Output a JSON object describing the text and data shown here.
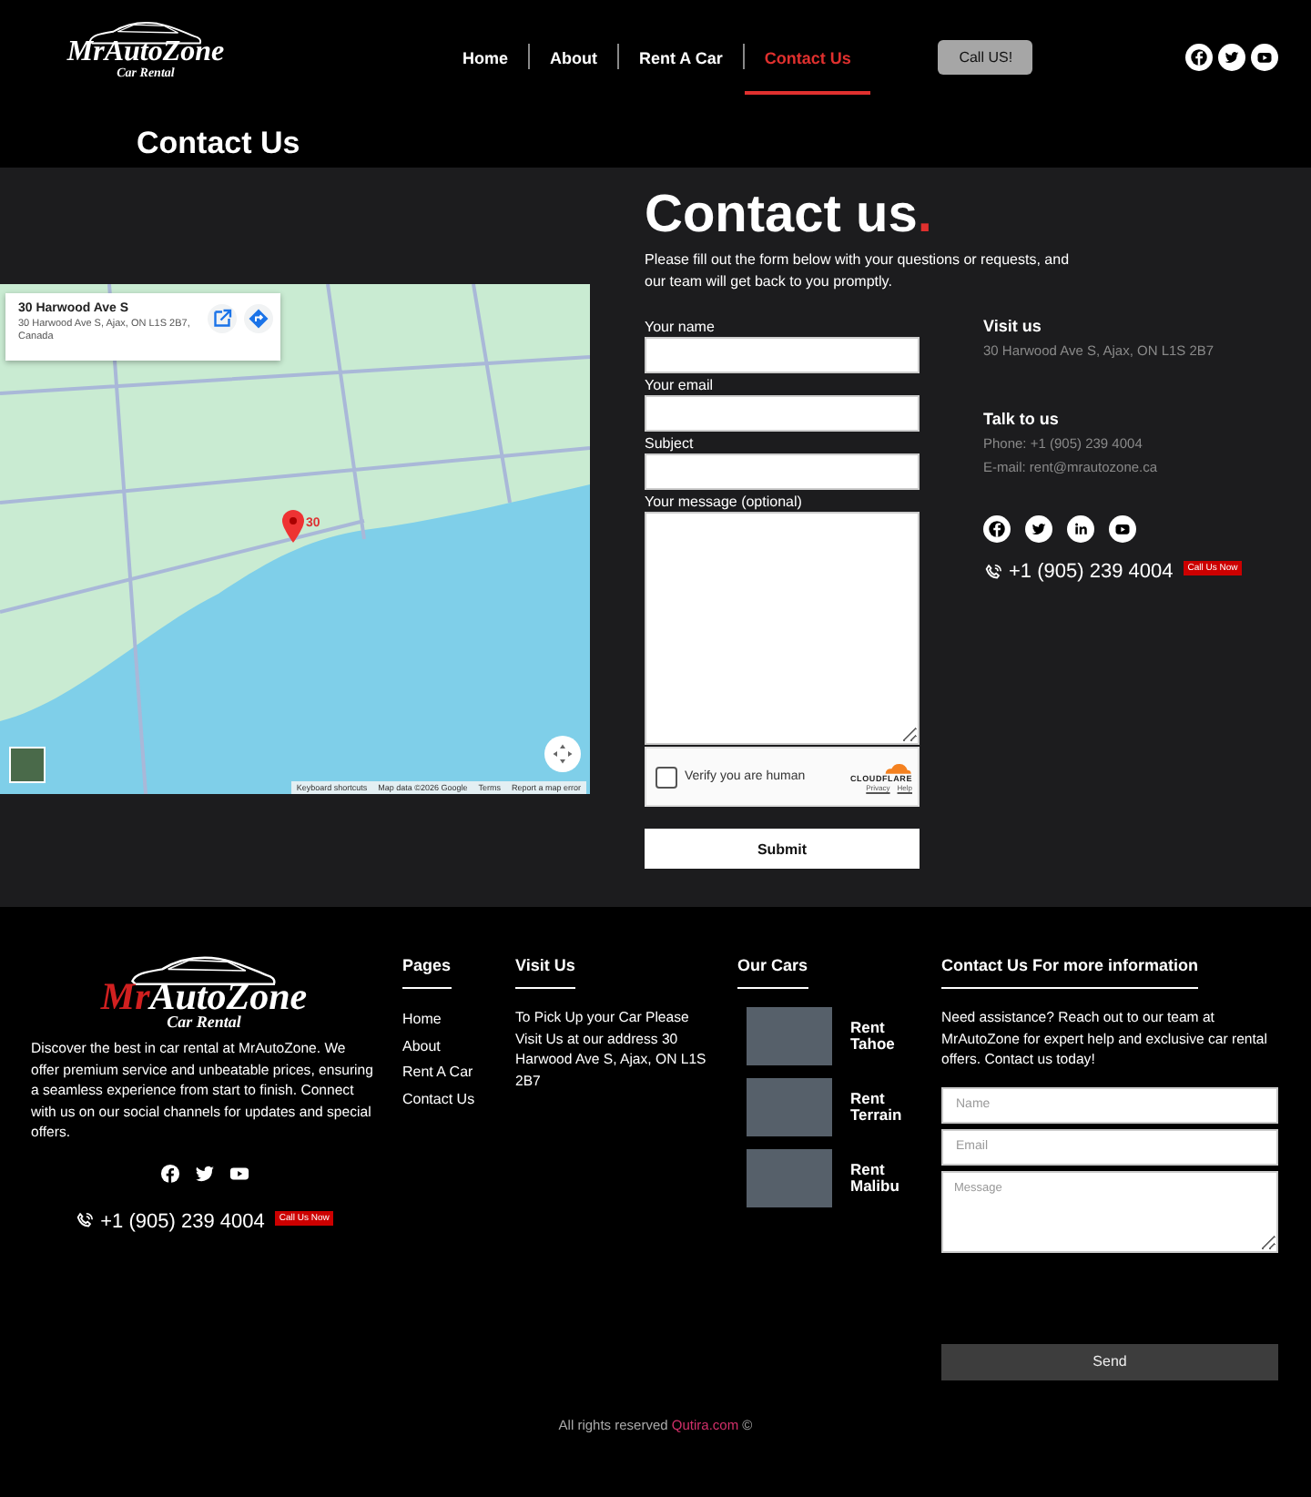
{
  "header": {
    "logo": {
      "name": "MrAutoZone",
      "tagline": "Car Rental"
    },
    "nav": [
      {
        "label": "Home",
        "selected": false
      },
      {
        "label": "About",
        "selected": false
      },
      {
        "label": "Rent A Car",
        "selected": false
      },
      {
        "label": "Contact Us",
        "selected": true
      }
    ],
    "call_button": "Call US!"
  },
  "page_title": "Contact Us",
  "map": {
    "place_title": "30 Harwood Ave S",
    "place_address": "30 Harwood Ave S, Ajax, ON L1S 2B7, Canada",
    "pin_label": "30",
    "footer_links": [
      "Keyboard shortcuts",
      "Map data ©2026 Google",
      "Terms",
      "Report a map error"
    ]
  },
  "contact": {
    "heading": "Contact us",
    "heading_dot": ".",
    "intro": "Please fill out the form below with your questions or requests, and our team will get back to you promptly.",
    "fields": [
      {
        "label": "Your name",
        "kind": "input"
      },
      {
        "label": "Your email",
        "kind": "input"
      },
      {
        "label": "Subject",
        "kind": "input"
      },
      {
        "label": "Your message (optional)",
        "kind": "textarea"
      }
    ],
    "captcha": {
      "label": "Verify you are human",
      "checked": false,
      "brand": "CLOUDFLARE",
      "links": [
        "Privacy",
        "Help"
      ]
    },
    "submit": "Submit"
  },
  "info": {
    "visit": {
      "heading": "Visit us",
      "text": "30 Harwood Ave S, Ajax, ON L1S 2B7"
    },
    "talk": {
      "heading": "Talk to us",
      "lines": [
        "Phone: +1 (905) 239 4004",
        "E-mail: rent@mrautozone.ca"
      ]
    },
    "phone": "+1 (905) 239 4004",
    "badge": "Call Us Now"
  },
  "footer": {
    "logo": {
      "name_a": "Mr",
      "name_b": "AutoZone",
      "tagline": "Car Rental"
    },
    "about": "Discover the best in car rental at MrAutoZone. We offer premium service and unbeatable prices, ensuring a seamless experience from start to finish. Connect with us on our social channels for updates and special offers.",
    "phone": "+1 (905) 239 4004",
    "badge": "Call Us Now",
    "pages": {
      "heading": "Pages",
      "links": [
        "Home",
        "About",
        "Rent A Car",
        "Contact Us"
      ]
    },
    "visit": {
      "heading": "Visit Us",
      "text": "To Pick Up your Car Please Visit Us at our address 30 Harwood Ave S, Ajax, ON L1S 2B7"
    },
    "cars": {
      "heading": "Our Cars",
      "items": [
        {
          "label": "Rent Tahoe"
        },
        {
          "label": "Rent Terrain"
        },
        {
          "label": "Rent Malibu"
        }
      ]
    },
    "form": {
      "heading": "Contact Us For more information",
      "text": "Need assistance? Reach out to our team at MrAutoZone for expert help and exclusive car rental offers. Contact us today!",
      "fields": [
        {
          "placeholder": "Name",
          "kind": "input"
        },
        {
          "placeholder": "Email",
          "kind": "input"
        },
        {
          "placeholder": "Message",
          "kind": "textarea"
        }
      ],
      "button": "Send"
    },
    "copyright": {
      "text": "All rights reserved",
      "link": "Qutira.com",
      "symbol": "©"
    }
  }
}
